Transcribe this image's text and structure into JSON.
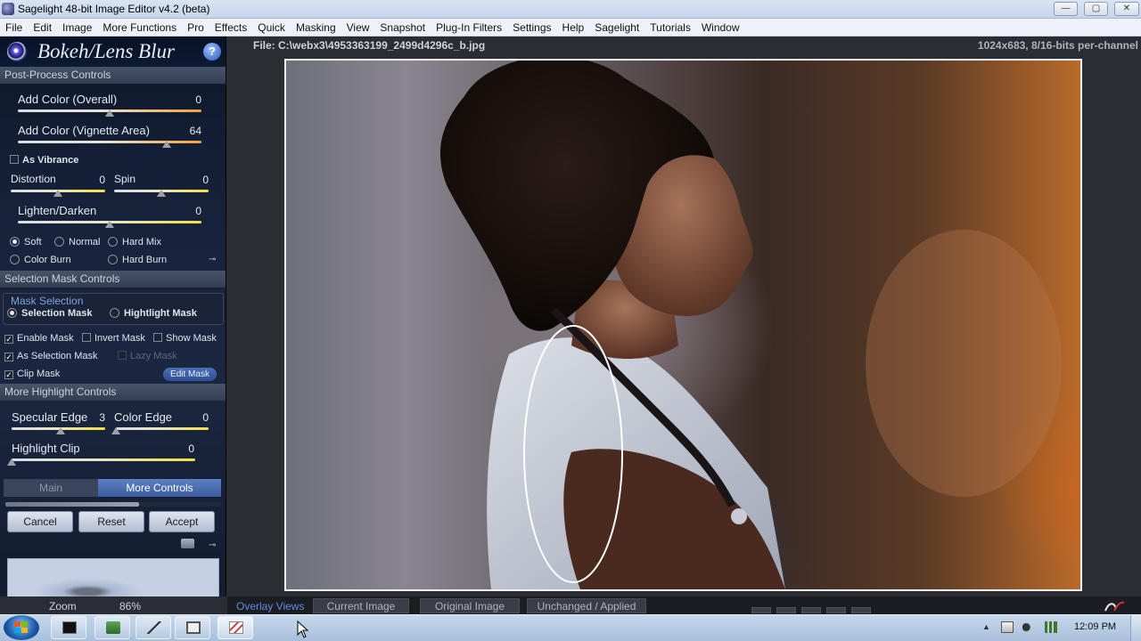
{
  "window": {
    "title": "Sagelight 48-bit Image Editor v4.2 (beta)",
    "min_symbol": "—",
    "max_symbol": "▢",
    "close_symbol": "✕"
  },
  "menu": [
    "File",
    "Edit",
    "Image",
    "More Functions",
    "Pro",
    "Effects",
    "Quick",
    "Masking",
    "View",
    "Snapshot",
    "Plug-In Filters",
    "Settings",
    "Help",
    "Sagelight",
    "Tutorials",
    "Window"
  ],
  "panel": {
    "title": "Bokeh/Lens Blur",
    "help_symbol": "?",
    "post_process_header": "Post-Process Controls",
    "sliders": {
      "add_color_overall": {
        "label": "Add Color (Overall)",
        "value": "0",
        "fraction": 0.5
      },
      "add_color_vignette": {
        "label": "Add Color (Vignette Area)",
        "value": "64",
        "fraction": 0.81
      },
      "distortion": {
        "label": "Distortion",
        "value": "0",
        "fraction": 0.5
      },
      "spin": {
        "label": "Spin",
        "value": "0",
        "fraction": 0.5
      },
      "lighten_darken": {
        "label": "Lighten/Darken",
        "value": "0",
        "fraction": 0.5
      },
      "specular_edge": {
        "label": "Specular Edge",
        "value": "3",
        "fraction": 0.52
      },
      "color_edge": {
        "label": "Color Edge",
        "value": "0",
        "fraction": 0.0
      },
      "highlight_clip": {
        "label": "Highlight Clip",
        "value": "0",
        "fraction": 0.0
      }
    },
    "as_vibrance": "As Vibrance",
    "blend_modes": [
      "Soft",
      "Normal",
      "Hard Mix",
      "Color Burn",
      "Hard Burn"
    ],
    "blend_selected": "Soft",
    "pin_symbol": "⊸",
    "selection_mask_header": "Selection Mask Controls",
    "mask_selection_label": "Mask Selection",
    "mask_options": [
      "Selection Mask",
      "Hightlight Mask"
    ],
    "enable_mask": "Enable Mask",
    "invert_mask": "Invert Mask",
    "show_mask": "Show Mask",
    "as_selection_mask": "As Selection Mask",
    "lazy_mask": "Lazy Mask",
    "clip_mask": "Clip Mask",
    "edit_mask": "Edit Mask",
    "more_highlight_header": "More Highlight Controls",
    "tabs": {
      "main": "Main",
      "more": "More Controls"
    },
    "progress_fraction": 0.62,
    "buttons": {
      "cancel": "Cancel",
      "reset": "Reset",
      "accept": "Accept"
    },
    "check_mark": "✓"
  },
  "canvas": {
    "file_path": "File: C:\\webx3\\4953363199_2499d4296c_b.jpg",
    "image_info": "1024x683, 8/16-bits per-channel"
  },
  "status": {
    "zoom_label": "Zoom",
    "zoom_value": "86%",
    "overlay_label": "Overlay Views",
    "overlay_buttons": [
      "Current Image",
      "Original Image",
      "Unchanged / Applied"
    ]
  },
  "taskbar": {
    "clock": "12:09 PM",
    "tray_arrow": "▲"
  },
  "colors": {
    "accent_blue": "#3b5c9e",
    "slider_orange": "#f0a23a",
    "slider_yellow": "#efe23d"
  }
}
